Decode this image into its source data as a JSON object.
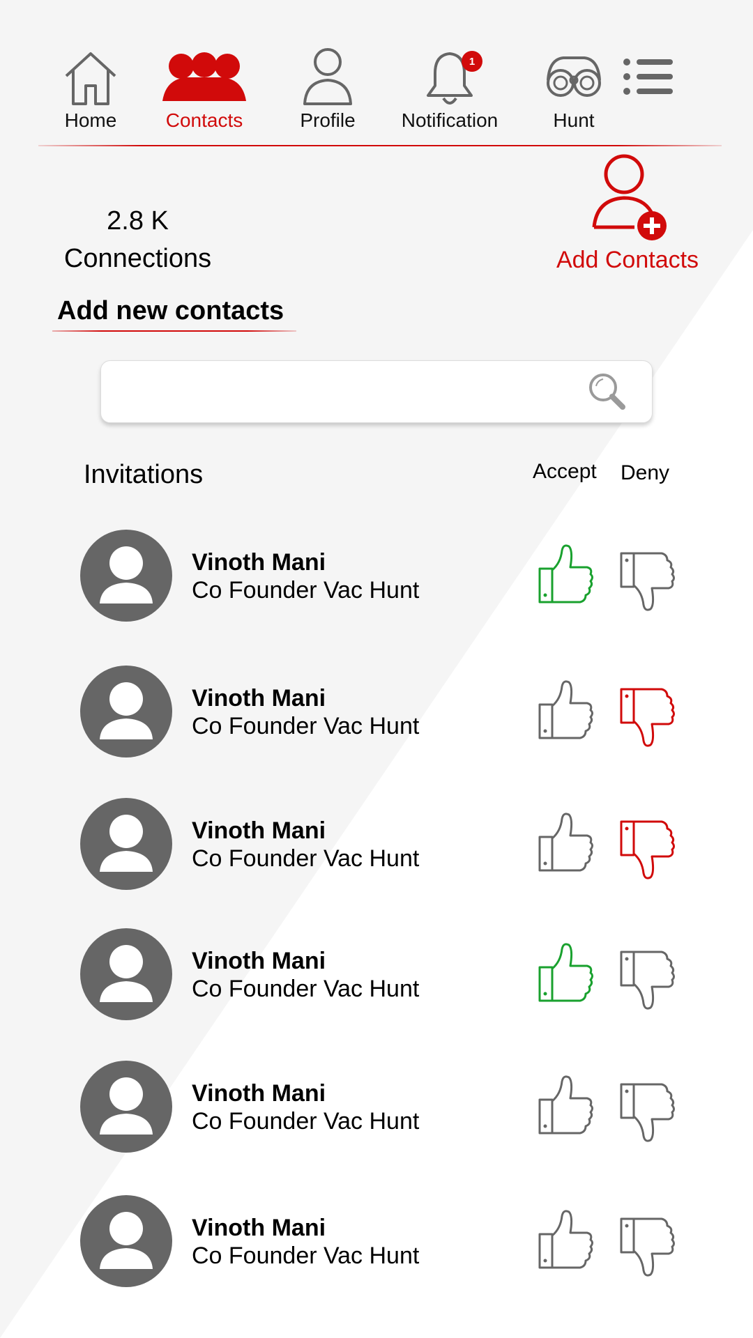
{
  "nav": {
    "items": [
      {
        "label": "Home",
        "icon": "home-icon"
      },
      {
        "label": "Contacts",
        "icon": "contacts-icon",
        "active": true
      },
      {
        "label": "Profile",
        "icon": "profile-icon"
      },
      {
        "label": "Notification",
        "icon": "bell-icon",
        "badge": "1"
      },
      {
        "label": "Hunt",
        "icon": "binoculars-icon"
      },
      {
        "label": "",
        "icon": "menu-icon"
      }
    ]
  },
  "stats": {
    "value": "2.8 K",
    "label": "Connections"
  },
  "add_contacts": {
    "label": "Add Contacts",
    "icon": "add-contact-icon"
  },
  "section": {
    "title": "Add new contacts"
  },
  "search": {
    "placeholder": "",
    "value": "",
    "icon": "search-icon"
  },
  "invitations": {
    "title": "Invitations",
    "accept_label": "Accept",
    "deny_label": "Deny",
    "rows": [
      {
        "name": "Vinoth Mani",
        "role": "Co Founder Vac Hunt",
        "status": "accepted"
      },
      {
        "name": "Vinoth Mani",
        "role": "Co Founder Vac Hunt",
        "status": "denied"
      },
      {
        "name": "Vinoth Mani",
        "role": "Co Founder Vac Hunt",
        "status": "denied"
      },
      {
        "name": "Vinoth Mani",
        "role": "Co Founder Vac Hunt",
        "status": "accepted"
      },
      {
        "name": "Vinoth Mani",
        "role": "Co Founder Vac Hunt",
        "status": "none"
      },
      {
        "name": "Vinoth Mani",
        "role": "Co Founder Vac Hunt",
        "status": "none"
      }
    ]
  },
  "colors": {
    "accent": "#d10a0a",
    "accept": "#19a12e",
    "neutral": "#666666",
    "background": "#f5f5f5"
  }
}
